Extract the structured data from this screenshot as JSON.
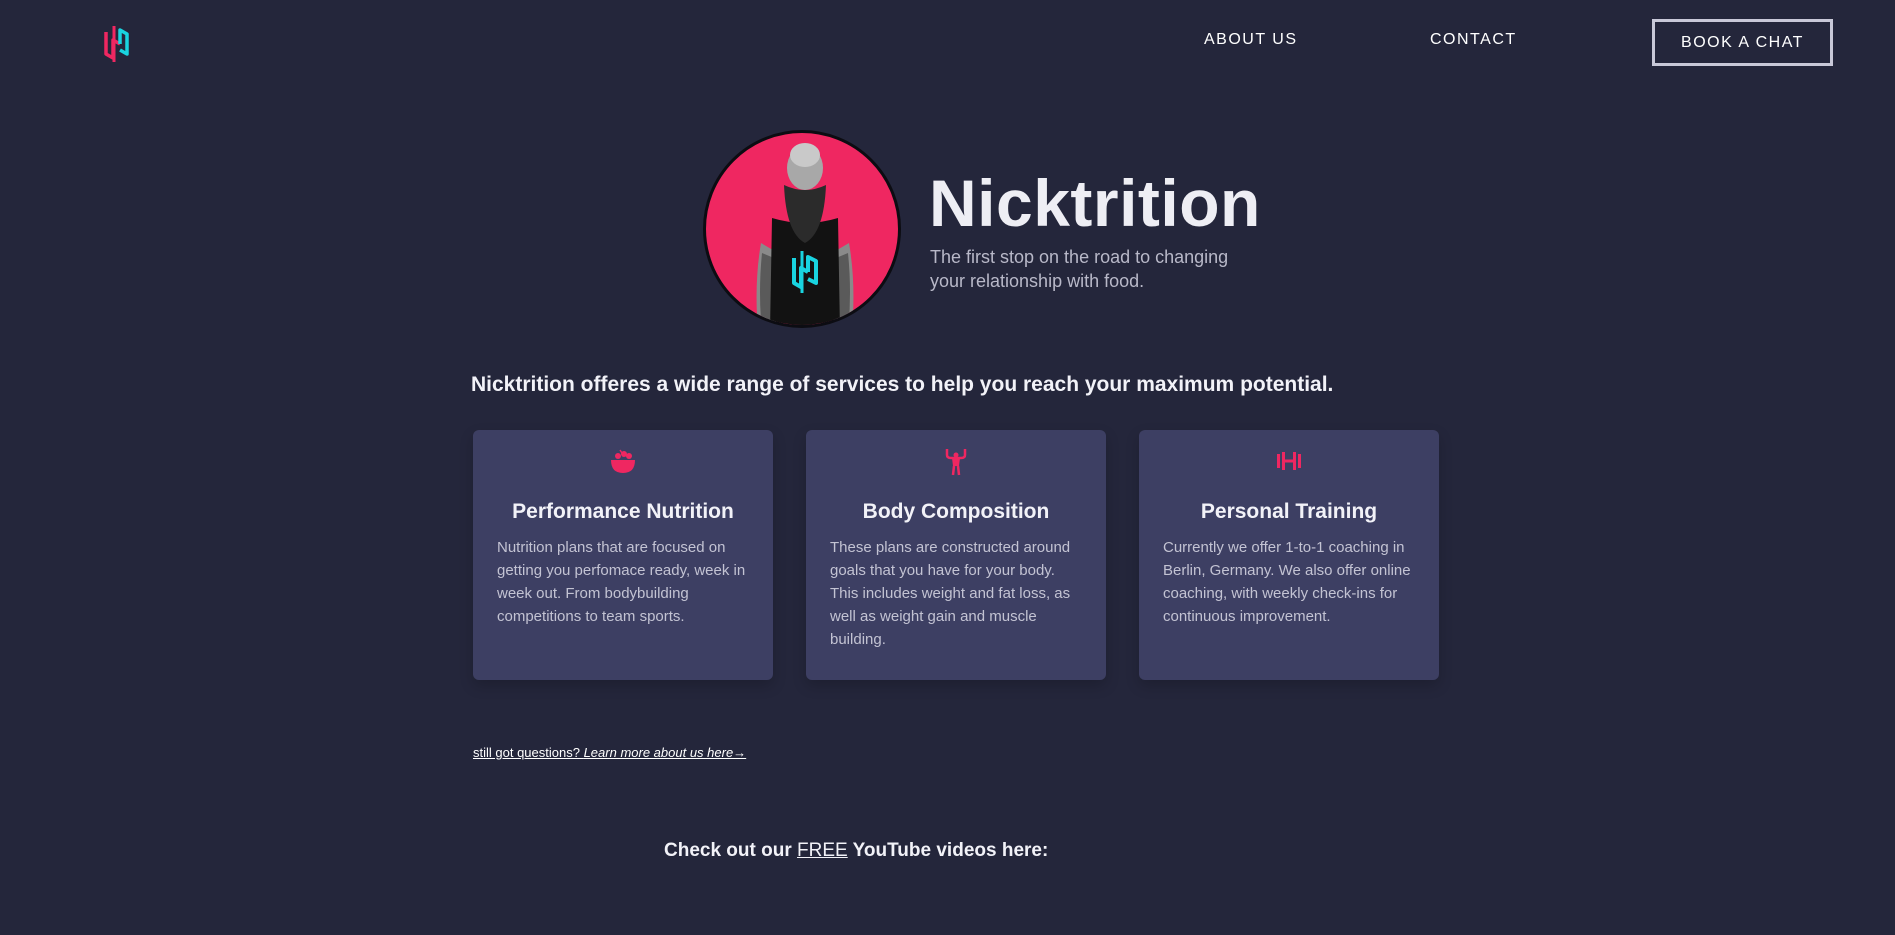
{
  "header": {
    "logo_icon": "nicktrition-logo-icon",
    "nav": {
      "about": "ABOUT US",
      "contact": "CONTACT"
    },
    "cta": "BOOK A CHAT"
  },
  "hero": {
    "title": "Nicktrition",
    "subtitle": "The first stop on the road to changing your relationship with food.",
    "avatar_bg": "#ef2761"
  },
  "intro": "Nicktrition offeres a wide range of services to help you reach your maximum potential.",
  "services": [
    {
      "icon": "bowl-icon",
      "title": "Performance Nutrition",
      "body": "Nutrition plans that are focused on getting you perfomace ready, week in week out. From bodybuilding competitions to team sports."
    },
    {
      "icon": "flexing-figure-icon",
      "title": "Body Composition",
      "body": "These plans are constructed around goals that you have for your body. This includes weight and fat loss, as well as weight gain and muscle building."
    },
    {
      "icon": "dumbbell-icon",
      "title": "Personal Training",
      "body": "Currently we offer 1-to-1 coaching in Berlin, Germany. We also offer online coaching, with weekly check-ins for continuous improvement."
    }
  ],
  "more": {
    "prefix": "still got questions? ",
    "link": "Learn more about us here→"
  },
  "youtube": {
    "before": "Check out our ",
    "free": "FREE",
    "after": " YouTube videos here:"
  },
  "colors": {
    "background": "#24263b",
    "card": "#3d3f63",
    "accent_pink": "#ef2761",
    "accent_cyan": "#19d4e0"
  }
}
